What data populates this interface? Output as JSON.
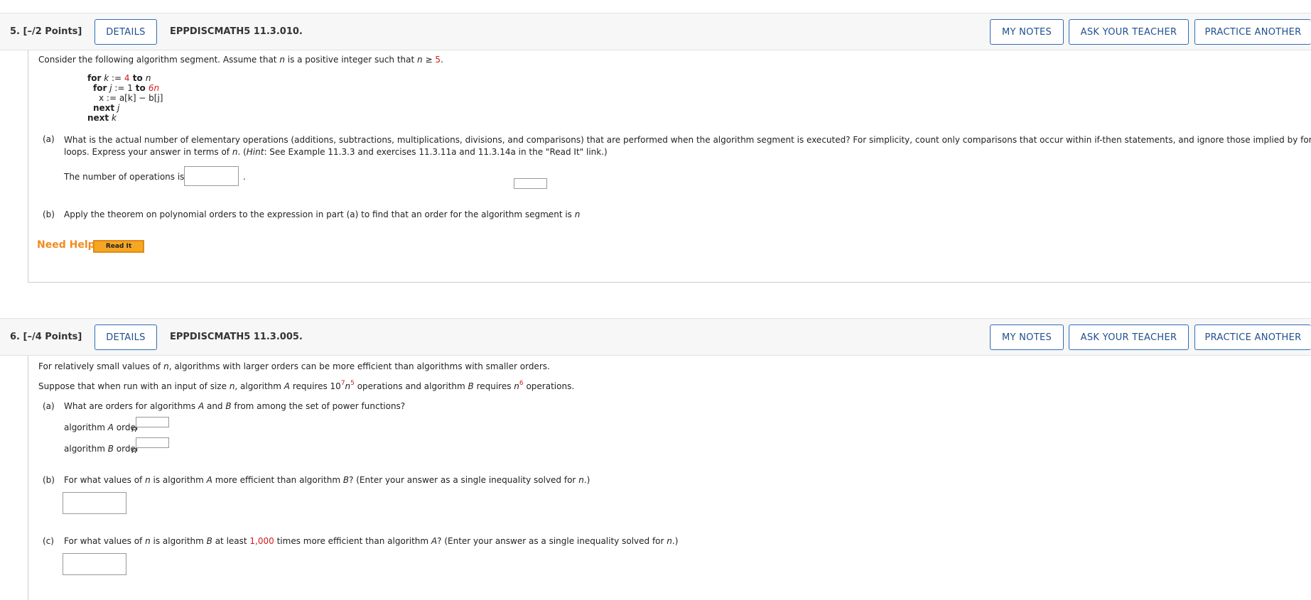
{
  "buttons": {
    "details": "DETAILS",
    "my_notes": "MY NOTES",
    "ask_teacher": "ASK YOUR TEACHER",
    "practice": "PRACTICE ANOTHER"
  },
  "q5": {
    "number": "5. [–/2 Points]",
    "code": "EPPDISCMATH5 11.3.010.",
    "intro_pre": "Consider the following algorithm segment. Assume that ",
    "intro_n": "n",
    "intro_mid": " is a positive integer such that ",
    "intro_n2": "n",
    "intro_ge": " ≥ ",
    "intro_val": "5",
    "intro_end": ".",
    "code_lines": {
      "l1_for": "for",
      "l1_var": "k",
      "l1_assign": " := ",
      "l1_start": "4",
      "l1_to": " to ",
      "l1_end": "n",
      "l2_for": "for",
      "l2_var": "j",
      "l2_assign": " := 1 ",
      "l2_to": "to ",
      "l2_end": "6n",
      "l3": "x := a[k] − b[j]",
      "l4_next": "next",
      "l4_var": "j",
      "l5_next": "next",
      "l5_var": "k"
    },
    "a_label": "(a)",
    "a_text1": "What is the actual number of elementary operations (additions, subtractions, multiplications, divisions, and comparisons) that are performed when the algorithm segment is executed? For simplicity, count only comparisons that occur within if-then statements, and ignore those implied by for-next",
    "a_text2_pre": "loops. Express your answer in terms of ",
    "a_text2_n": "n",
    "a_text2_mid": ". (",
    "a_text2_hint": "Hint",
    "a_text2_end": ": See Example 11.3.3 and exercises 11.3.11a and 11.3.14a in the \"Read It\" link.)",
    "a_answer_label": "The number of operations is",
    "a_answer_end": ".",
    "b_label": "(b)",
    "b_text": "Apply the theorem on polynomial orders to the expression in part (a) to find that an order for the algorithm segment is ",
    "b_n": "n",
    "b_end": ".",
    "need_help": "Need Help?",
    "read_it": "Read It"
  },
  "q6": {
    "number": "6. [–/4 Points]",
    "code": "EPPDISCMATH5 11.3.005.",
    "p1_pre": "For relatively small values of ",
    "p1_n": "n",
    "p1_end": ", algorithms with larger orders can be more efficient than algorithms with smaller orders.",
    "p2_pre": "Suppose that when run with an input of size ",
    "p2_n": "n",
    "p2_mid1": ", algorithm ",
    "p2_A": "A",
    "p2_mid2": " requires 10",
    "p2_exp7": "7",
    "p2_n2": "n",
    "p2_exp5": "5",
    "p2_mid3": " operations and algorithm ",
    "p2_B": "B",
    "p2_mid4": " requires ",
    "p2_n3": "n",
    "p2_exp6": "6",
    "p2_end": " operations.",
    "a_label": "(a)",
    "a_text_pre": "What are orders for algorithms ",
    "a_A": "A",
    "a_and": " and ",
    "a_B": "B",
    "a_text_end": " from among the set of power functions?",
    "a_rowA_pre": "algorithm ",
    "a_rowA_var": "A",
    "a_rowA_post": " order",
    "a_rowB_pre": "algorithm ",
    "a_rowB_var": "B",
    "a_rowB_post": " order",
    "a_n": "n",
    "b_label": "(b)",
    "b_pre": "For what values of ",
    "b_n": "n",
    "b_mid": " is algorithm ",
    "b_A": "A",
    "b_mid2": " more efficient than algorithm ",
    "b_B": "B",
    "b_end": "? (Enter your answer as a single inequality solved for ",
    "b_n2": "n",
    "b_end2": ".)",
    "c_label": "(c)",
    "c_pre": "For what values of ",
    "c_n": "n",
    "c_mid": " is algorithm ",
    "c_B": "B",
    "c_mid2": " at least ",
    "c_num": "1,000",
    "c_mid3": " times more efficient than algorithm ",
    "c_A": "A",
    "c_end": "? (Enter your answer as a single inequality solved for ",
    "c_n2": "n",
    "c_end2": ".)"
  }
}
